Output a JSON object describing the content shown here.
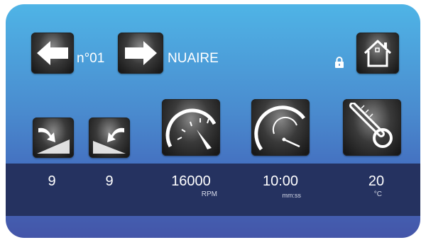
{
  "header": {
    "device_number": "n°01",
    "brand": "NUAIRE"
  },
  "icons": {
    "prev": "arrow-left-icon",
    "next": "arrow-right-icon",
    "lock": "lock-icon",
    "home": "home-icon",
    "fan_in": "fan-flow-in-icon",
    "fan_out": "fan-flow-out-icon",
    "speed": "speedometer-icon",
    "timer": "stopwatch-icon",
    "temp": "thermometer-icon"
  },
  "readings": {
    "fan_in": {
      "value": "9"
    },
    "fan_out": {
      "value": "9"
    },
    "speed": {
      "value": "16000",
      "unit": "RPM"
    },
    "timer": {
      "value": "10:00",
      "unit": "mm:ss"
    },
    "temperature": {
      "value": "20",
      "unit": "°C"
    }
  },
  "colors": {
    "panel_top": "#4fb4e6",
    "panel_bottom": "#4455a8",
    "readout_bar": "#253260",
    "text": "#ffffff"
  }
}
